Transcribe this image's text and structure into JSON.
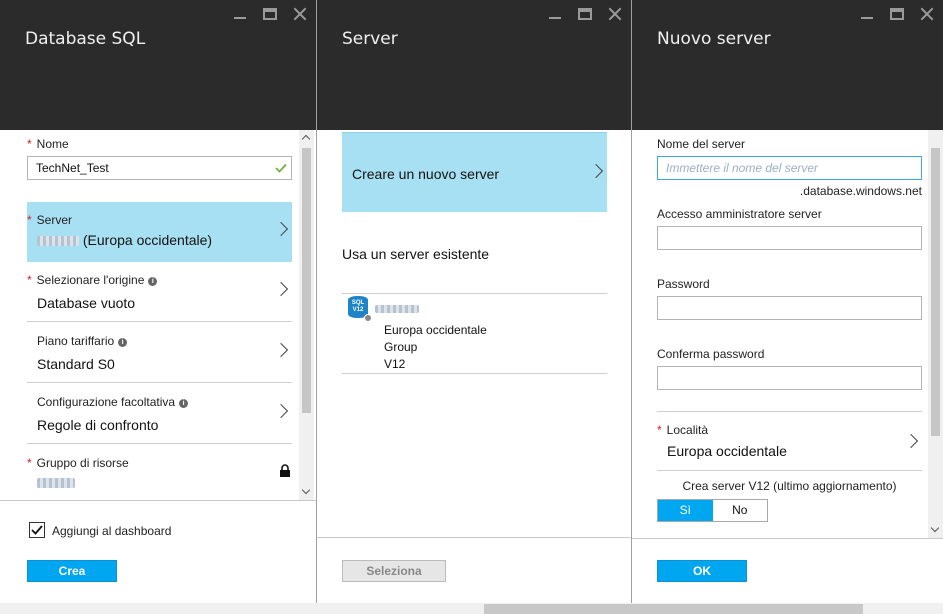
{
  "blade1": {
    "title": "Database SQL",
    "name_label": "Nome",
    "name_value": "TechNet_Test",
    "server_label": "Server",
    "server_value": "(Europa occidentale)",
    "source_label": "Selezionare l'origine",
    "source_value": "Database vuoto",
    "pricing_label": "Piano tariffario",
    "pricing_value": "Standard S0",
    "optional_label": "Configurazione facoltativa",
    "optional_value": "Regole di confronto",
    "rg_label": "Gruppo di risorse",
    "pin_label": "Aggiungi al dashboard",
    "pin_checked": true,
    "create_button": "Crea"
  },
  "blade2": {
    "title": "Server",
    "new_server": "Creare un nuovo server",
    "existing_heading": "Usa un server esistente",
    "server_item": {
      "icon_line1": "SQL",
      "icon_line2": "V12",
      "location": "Europa occidentale",
      "group": "Group",
      "version": "V12"
    },
    "select_button": "Seleziona"
  },
  "blade3": {
    "title": "Nuovo server",
    "server_name_label": "Nome del server",
    "server_name_placeholder": "Immettere il nome del server",
    "server_name_value": "",
    "domain_suffix": ".database.windows.net",
    "admin_label": "Accesso amministratore server",
    "admin_value": "",
    "password_label": "Password",
    "password_value": "",
    "confirm_label": "Conferma password",
    "confirm_value": "",
    "location_label": "Località",
    "location_value": "Europa occidentale",
    "v12_label": "Crea server V12 (ultimo aggiornamento)",
    "v12_yes": "Sì",
    "v12_no": "No",
    "v12_selected": "yes",
    "ok_button": "OK"
  },
  "colors": {
    "header_bg": "#2b2b2b",
    "selected_row": "#a8e0f3",
    "accent_button": "#00a6f0",
    "required_star": "#d42020",
    "check_green": "#6cb33e"
  }
}
